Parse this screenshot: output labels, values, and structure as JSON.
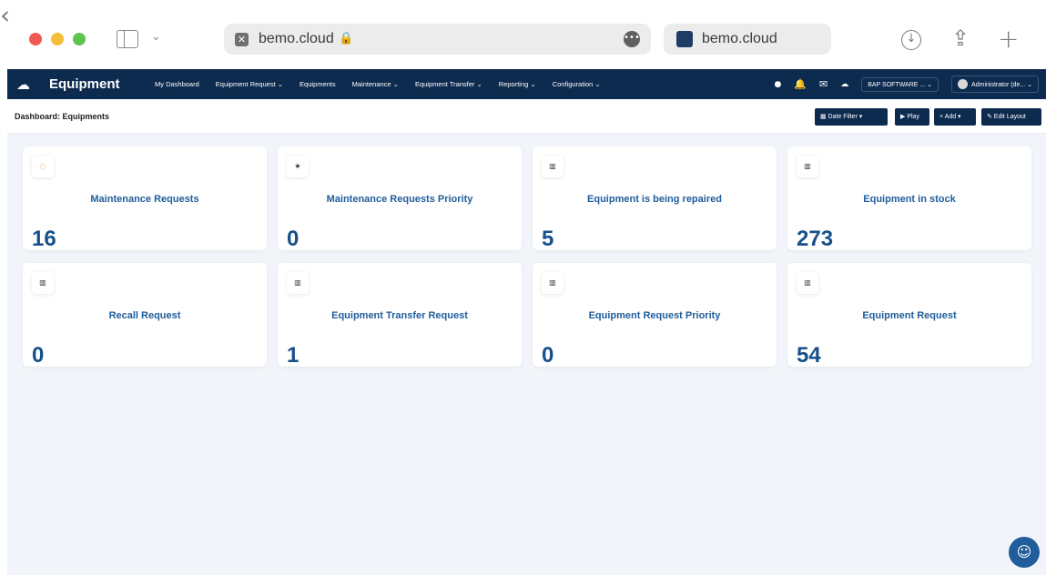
{
  "browser": {
    "url": "bemo.cloud",
    "tab_title": "bemo.cloud",
    "icons": {
      "favicon": "close-box-icon",
      "lock": "lock-icon",
      "more": "ellipsis-icon",
      "download": "download-icon",
      "share": "share-icon",
      "new_tab": "plus-icon"
    }
  },
  "nav": {
    "app_name": "Equipment",
    "menu": [
      "My Dashboard",
      "Equipment Request ⌄",
      "Equipments",
      "Maintenance ⌄",
      "Equipment Transfer ⌄",
      "Reporting ⌄",
      "Configuration ⌄"
    ],
    "company": "BAP SOFTWARE ... ⌄",
    "user": "Administrator (de... ⌄",
    "colors": {
      "navbar": "#0d2b4f",
      "badge": "#e0284a"
    }
  },
  "toolbar": {
    "breadcrumb": "Dashboard: Equipments",
    "date_filter": "▦ Date Filter ▾",
    "play": "▶ Play",
    "add": "+ Add ▾",
    "edit_layout": "✎ Edit Layout"
  },
  "cards": [
    {
      "title": "Maintenance Requests",
      "value": "16",
      "icon": "clock-icon"
    },
    {
      "title": "Maintenance Requests Priority",
      "value": "0",
      "icon": "star-icon"
    },
    {
      "title": "Equipment is being repaired",
      "value": "5",
      "icon": "bar-chart-icon"
    },
    {
      "title": "Equipment in stock",
      "value": "273",
      "icon": "bar-chart-icon"
    },
    {
      "title": "Recall Request",
      "value": "0",
      "icon": "bar-chart-icon"
    },
    {
      "title": "Equipment Transfer Request",
      "value": "1",
      "icon": "bar-chart-icon"
    },
    {
      "title": "Equipment Request Priority",
      "value": "0",
      "icon": "bar-chart-icon"
    },
    {
      "title": "Equipment Request",
      "value": "54",
      "icon": "bar-chart-icon"
    }
  ],
  "colors": {
    "card_title": "#1f5d9b",
    "card_value": "#16508a",
    "content_bg": "#f1f4f8"
  }
}
